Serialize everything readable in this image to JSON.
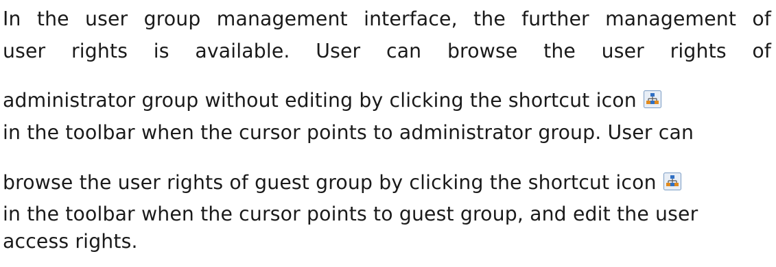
{
  "paragraph": {
    "line1": [
      "In",
      "the",
      "user",
      "group",
      "management",
      "interface,",
      "the",
      "further",
      "management",
      "of"
    ],
    "line2": [
      "user",
      "rights",
      "is",
      "available.",
      "User",
      "can",
      "browse",
      "the",
      "user",
      "rights",
      "of"
    ],
    "line3": "administrator group without editing by clicking the shortcut icon",
    "line4": "in the toolbar when the cursor points to administrator group. User can",
    "line5": "browse the user rights of guest group by clicking the shortcut icon",
    "line6": "in the toolbar when the cursor points to guest group, and edit the user",
    "line7": "access rights."
  },
  "icons": {
    "shortcut_icon": "user-rights-hierarchy-icon",
    "colors": {
      "frame": "#7a9cc4",
      "background": "#e8eef6",
      "blue_node": "#2f6fc4",
      "orange_node": "#e08a1e"
    }
  }
}
